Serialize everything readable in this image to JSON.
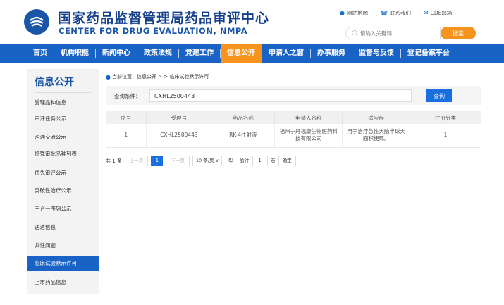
{
  "header": {
    "title_cn": "国家药品监督管理局药品审评中心",
    "title_en": "CENTER FOR DRUG EVALUATION, NMPA",
    "links": [
      {
        "icon": "location-pin-icon",
        "label": "网站地图"
      },
      {
        "icon": "phone-icon",
        "label": "联系我们"
      },
      {
        "icon": "mail-icon",
        "label": "CDE邮箱"
      }
    ],
    "search_placeholder": "请输入关键词",
    "search_button": "搜索"
  },
  "nav": {
    "items": [
      "首页",
      "机构职能",
      "新闻中心",
      "政策法规",
      "党建工作",
      "信息公开",
      "申请人之窗",
      "办事服务",
      "监督与反馈",
      "登记备案平台"
    ],
    "active_index": 5
  },
  "sidebar": {
    "title": "信息公开",
    "items": [
      "受理品种信息",
      "审评任务公示",
      "沟通交流公示",
      "特殊审批品种列表",
      "优先审评公示",
      "突破性治疗公示",
      "三合一序列公示",
      "送达信息",
      "共性问题",
      "临床试验默示许可",
      "上市药品信息"
    ],
    "active_index": 9
  },
  "breadcrumb": {
    "text": "当前位置：信息公开 > > 临床试验默示许可"
  },
  "query": {
    "label": "查询条件：",
    "value": "CXHL2500443",
    "button": "查询"
  },
  "table": {
    "headers": [
      "序号",
      "受理号",
      "药品名称",
      "申请人名称",
      "适应症",
      "注册分类"
    ],
    "rows": [
      [
        "1",
        "CXHL2500443",
        "RK-4注射液",
        "福州宁丹福康生物医药科技有限公司",
        "用于治疗急性大脑半球大面积梗死。",
        "1"
      ]
    ]
  },
  "pager": {
    "total": "共 1 条",
    "prev": "上一页",
    "current": "1",
    "next": "下一页",
    "page_size": "10 条/页 ∨",
    "goto_label": "前往",
    "goto_value": "1",
    "page_unit": "页",
    "confirm": "确定"
  },
  "colors": {
    "brand_blue": "#1a63c6",
    "accent_orange": "#f7941d",
    "title_blue": "#143f8c"
  }
}
